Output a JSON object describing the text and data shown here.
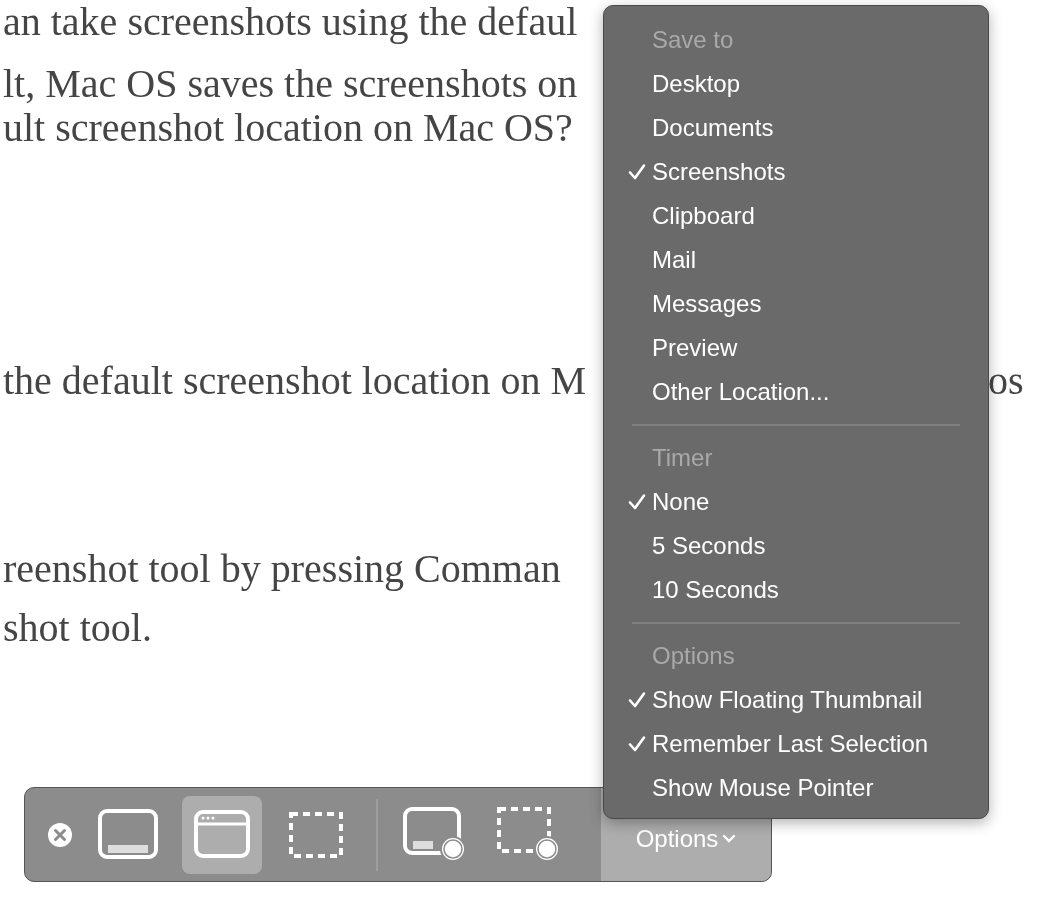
{
  "article": {
    "lines": [
      {
        "text": "an take screenshots using the defaul"
      },
      {
        "text": "lt, Mac OS saves the screenshots on"
      },
      {
        "text": "ult screenshot location on Mac OS?"
      },
      {
        "text": "the default screenshot location on M"
      },
      {
        "text": "reenshot tool by pressing Comman"
      },
      {
        "text": "shot tool."
      }
    ],
    "side_text": "os"
  },
  "menu": {
    "sections": [
      {
        "header": "Save to",
        "items": [
          {
            "label": "Desktop",
            "checked": false
          },
          {
            "label": "Documents",
            "checked": false
          },
          {
            "label": "Screenshots",
            "checked": true
          },
          {
            "label": "Clipboard",
            "checked": false
          },
          {
            "label": "Mail",
            "checked": false
          },
          {
            "label": "Messages",
            "checked": false
          },
          {
            "label": "Preview",
            "checked": false
          },
          {
            "label": "Other Location...",
            "checked": false
          }
        ]
      },
      {
        "header": "Timer",
        "items": [
          {
            "label": "None",
            "checked": true
          },
          {
            "label": "5 Seconds",
            "checked": false
          },
          {
            "label": "10 Seconds",
            "checked": false
          }
        ]
      },
      {
        "header": "Options",
        "items": [
          {
            "label": "Show Floating Thumbnail",
            "checked": true
          },
          {
            "label": "Remember Last Selection",
            "checked": true
          },
          {
            "label": "Show Mouse Pointer",
            "checked": false
          }
        ]
      }
    ]
  },
  "toolbar": {
    "capture_tools": [
      {
        "kind": "screen",
        "selected": false
      },
      {
        "kind": "window",
        "selected": true
      },
      {
        "kind": "selection",
        "selected": false
      }
    ],
    "record_tools": [
      {
        "kind": "record-screen",
        "selected": false
      },
      {
        "kind": "record-selection",
        "selected": false
      }
    ],
    "options_label": "Options"
  }
}
